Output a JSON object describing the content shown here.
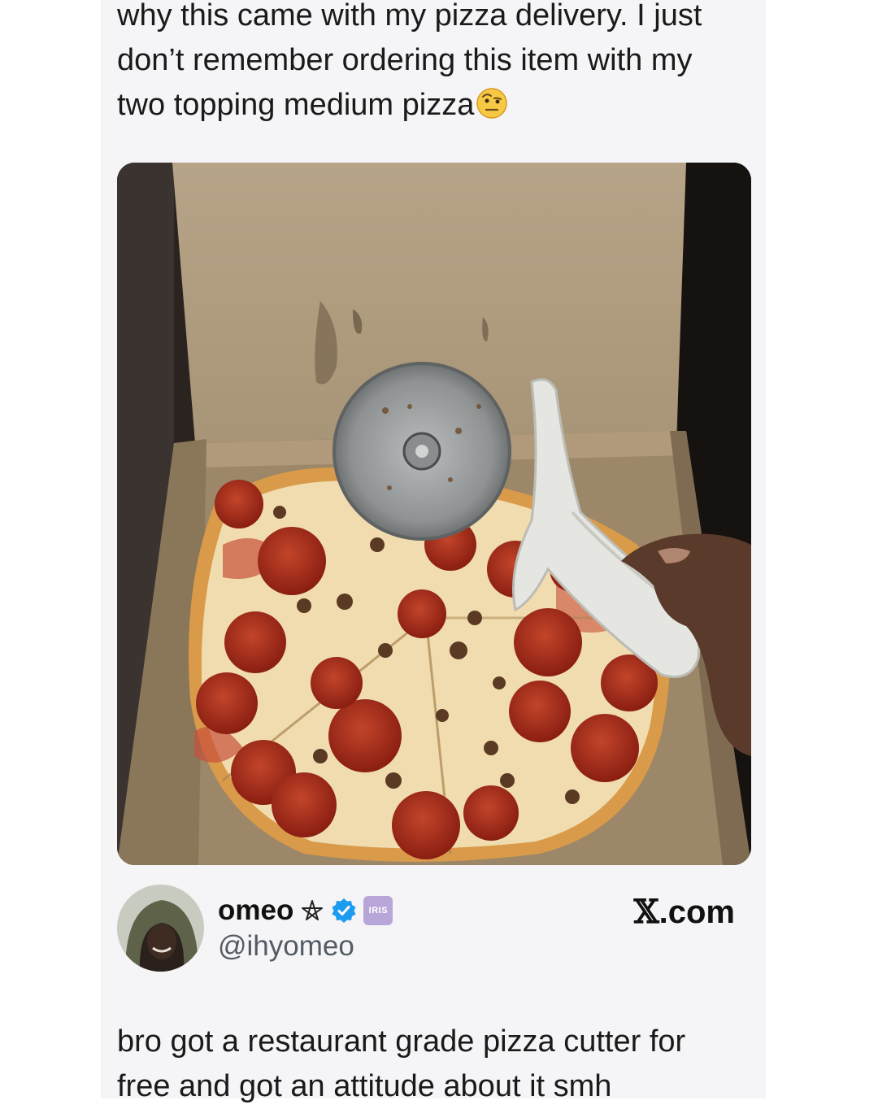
{
  "post": {
    "text_lines": [
      "why this came with my pizza delivery. I just",
      "don’t remember ordering this item with my",
      "two topping medium pizza"
    ],
    "emoji": "face-with-raised-eyebrow"
  },
  "author": {
    "display_name": "omeo",
    "handle": "@ihyomeo",
    "badge_text": "IRIS",
    "site_prefix": "𝕏",
    "site_suffix": ".com"
  },
  "reply": {
    "text_lines": [
      "bro got a restaurant grade pizza cutter for",
      "free and got an attitude about it smh"
    ]
  },
  "colors": {
    "card_background": "#f5f5f7",
    "verified_blue": "#1d9bf0",
    "iris_badge": "#b9a6d9",
    "handle_gray": "#555b63"
  }
}
